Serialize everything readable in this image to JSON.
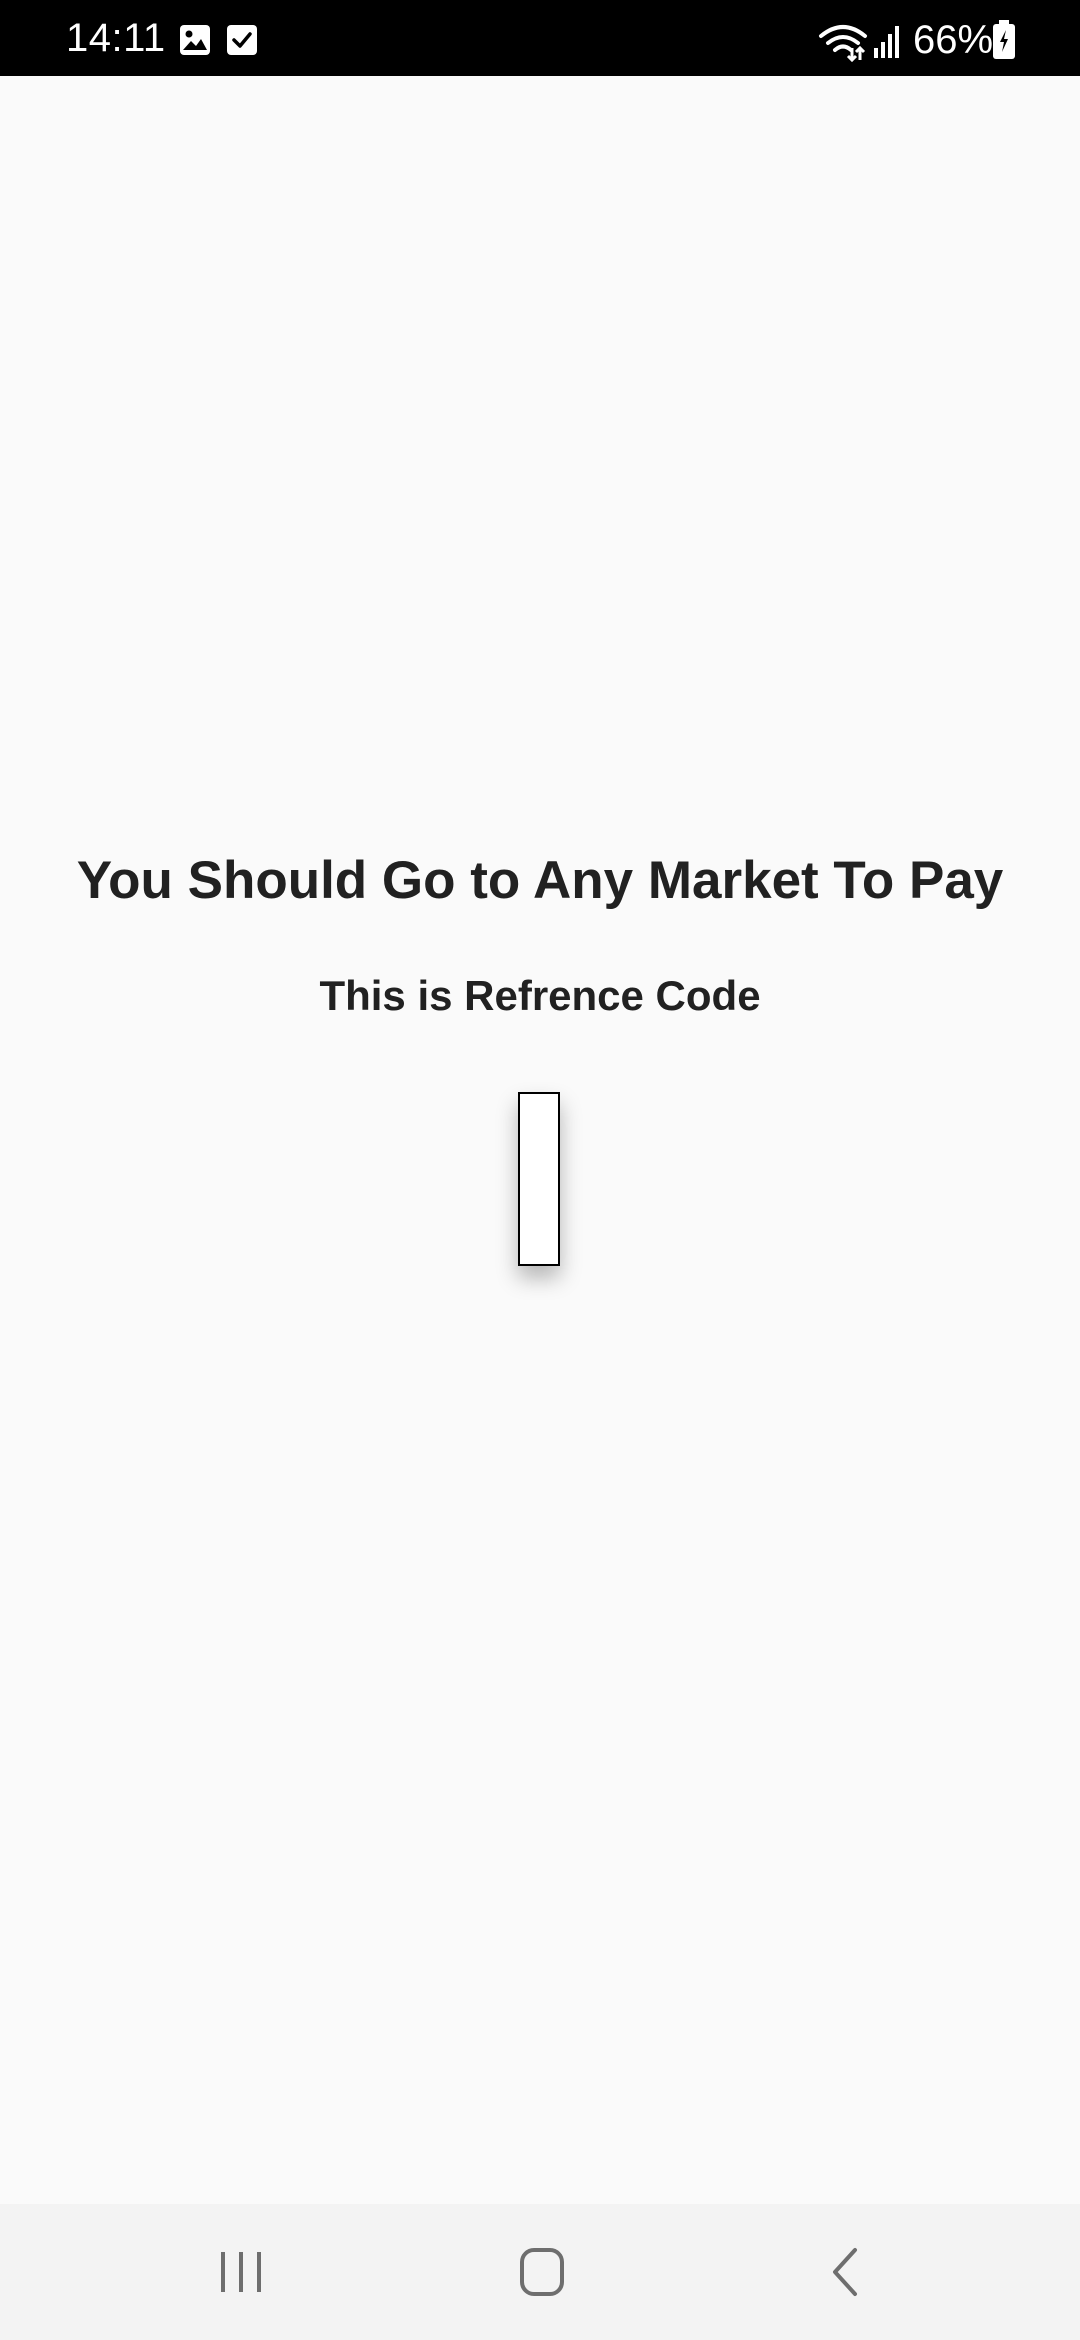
{
  "status_bar": {
    "time": "14:11",
    "battery": "66%",
    "icons": [
      "gallery-icon",
      "checkbox-icon",
      "wifi-icon",
      "signal-icon",
      "battery-icon"
    ]
  },
  "screen": {
    "title": "You Should Go to Any Market To Pay",
    "subtitle": "This is Refrence Code",
    "reference_code": ""
  },
  "nav_bar": {
    "icons": [
      "recent-apps-icon",
      "home-icon",
      "back-icon"
    ]
  }
}
